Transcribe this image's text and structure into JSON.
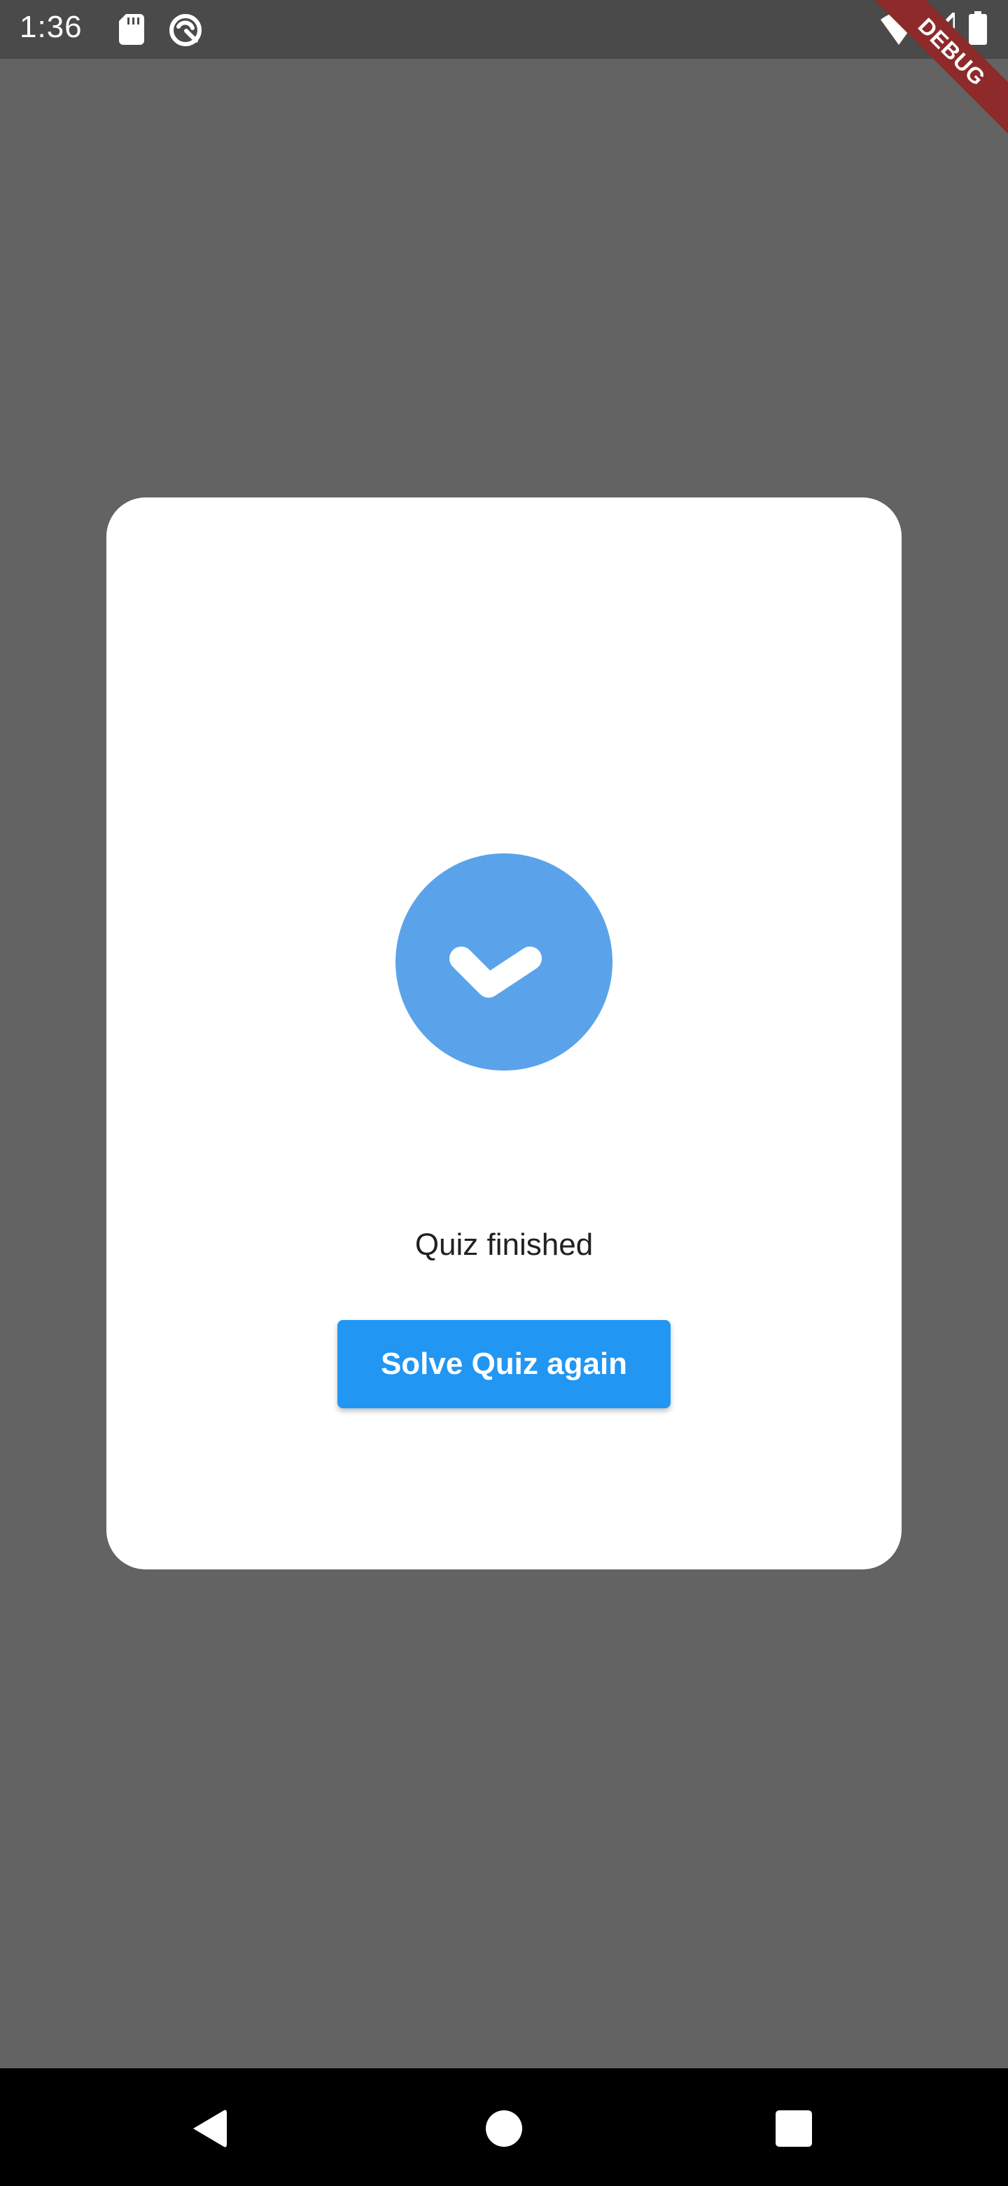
{
  "status_bar": {
    "time": "1:36",
    "icons": [
      "sd-card-icon",
      "sync-icon",
      "wifi-icon",
      "signal-icon",
      "battery-icon"
    ]
  },
  "debug_banner": {
    "label": "DEBUG"
  },
  "dialog": {
    "icon": "check-chevron-icon",
    "message": "Quiz finished",
    "button_label": "Solve Quiz again"
  },
  "nav_bar": {
    "icons": [
      "back-icon",
      "home-icon",
      "recents-icon"
    ]
  },
  "colors": {
    "scrim": "#636363",
    "status_bar": "#4a4a4a",
    "dialog_bg": "#ffffff",
    "icon_circle": "#5aa3ea",
    "button_bg": "#2196f3",
    "debug_ribbon": "#8e2a2a",
    "nav_bar": "#000000"
  }
}
